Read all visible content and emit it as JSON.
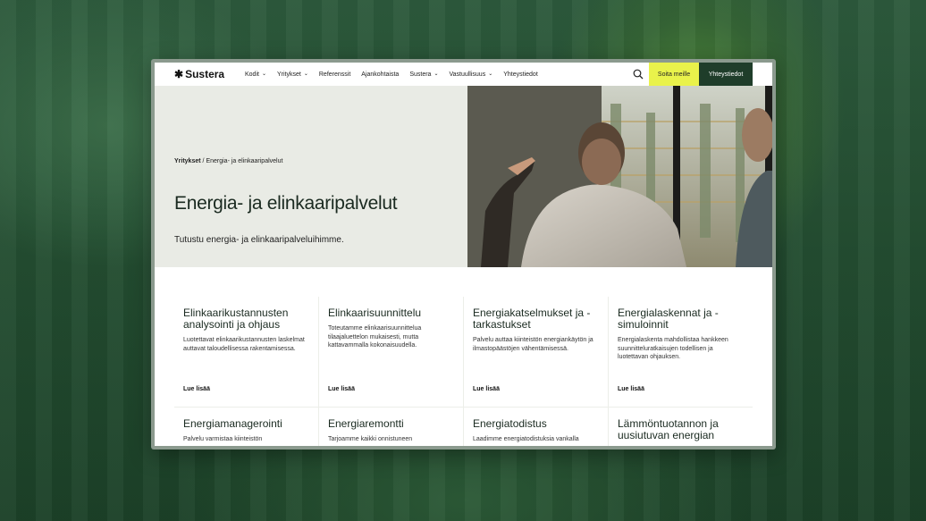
{
  "logo": {
    "mark": "✱",
    "name": "Sustera"
  },
  "nav": [
    {
      "label": "Kodit",
      "dropdown": true
    },
    {
      "label": "Yritykset",
      "dropdown": true
    },
    {
      "label": "Referenssit",
      "dropdown": false
    },
    {
      "label": "Ajankohtaista",
      "dropdown": false
    },
    {
      "label": "Sustera",
      "dropdown": true
    },
    {
      "label": "Vastuullisuus",
      "dropdown": true
    },
    {
      "label": "Yhteystiedot",
      "dropdown": false
    }
  ],
  "header": {
    "call_label": "Soita meille",
    "contact_label": "Yhteystiedot"
  },
  "hero": {
    "breadcrumb_parent": "Yritykset",
    "breadcrumb_separator": "/",
    "breadcrumb_current": "Energia- ja elinkaaripalvelut",
    "title": "Energia- ja elinkaaripalvelut",
    "subtitle": "Tutustu energia- ja elinkaaripalveluihimme."
  },
  "cards": [
    {
      "title": "Elinkaarikustannusten analysointi ja ohjaus",
      "desc": "Luotettavat elinkaarikustannusten laskelmat auttavat taloudellisessa rakentamisessa.",
      "link": "Lue lisää"
    },
    {
      "title": "Elinkaarisuunnittelu",
      "desc": "Toteutamme elinkaarisuunnittelua tilaajaluettelon mukaisesti, mutta kattavammalla kokonaisuudella.",
      "link": "Lue lisää"
    },
    {
      "title": "Energiakatselmukset ja -tarkastukset",
      "desc": "Palvelu auttaa kiinteistön energiankäytön ja ilmastopäästöjen vähentämisessä.",
      "link": "Lue lisää"
    },
    {
      "title": "Energialaskennat ja -simuloinnit",
      "desc": "Energialaskenta mahdollistaa hankkeen suunnitteluratkaisujen todellisen ja luotettavan ohjauksen.",
      "link": "Lue lisää"
    },
    {
      "title": "Energiamanagerointi",
      "desc": "Palvelu varmistaa kiinteistön",
      "link": ""
    },
    {
      "title": "Energiaremontti",
      "desc": "Tarjoamme kaikki onnistuneen",
      "link": ""
    },
    {
      "title": "Energiatodistus",
      "desc": "Laadimme energiatodistuksia vankalla",
      "link": ""
    },
    {
      "title": "Lämmöntuotannon ja uusiutuvan energian",
      "desc": "",
      "link": ""
    }
  ],
  "colors": {
    "accent_yellow": "#e9f24b",
    "dark_green": "#1f3d2a",
    "hero_bg": "#e9ebe5"
  }
}
